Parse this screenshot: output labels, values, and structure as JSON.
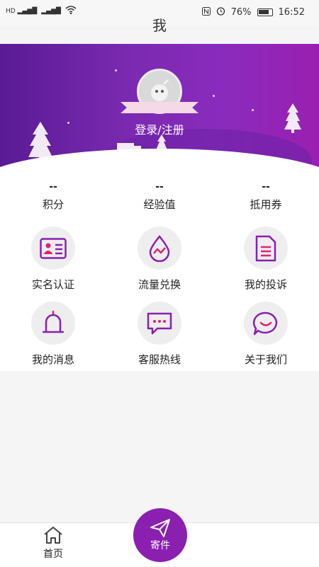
{
  "status_bar": {
    "battery": "76%",
    "time": "16:52"
  },
  "title": "我",
  "profile": {
    "login_text": "登录/注册"
  },
  "stats": [
    {
      "value": "--",
      "label": "积分"
    },
    {
      "value": "--",
      "label": "经验值"
    },
    {
      "value": "--",
      "label": "抵用券"
    }
  ],
  "grid": [
    {
      "label": "实名认证",
      "icon": "id-card-icon"
    },
    {
      "label": "流量兑换",
      "icon": "droplet-icon"
    },
    {
      "label": "我的投诉",
      "icon": "document-icon"
    },
    {
      "label": "我的消息",
      "icon": "bell-icon"
    },
    {
      "label": "客服热线",
      "icon": "chat-bubble-icon"
    },
    {
      "label": "关于我们",
      "icon": "smile-bubble-icon"
    }
  ],
  "nav": {
    "home_label": "首页",
    "send_label": "寄件"
  },
  "colors": {
    "accent": "#8a1fb0",
    "pink": "#e0207a",
    "hero_start": "#5a1a95",
    "hero_end": "#9a1fb0"
  }
}
